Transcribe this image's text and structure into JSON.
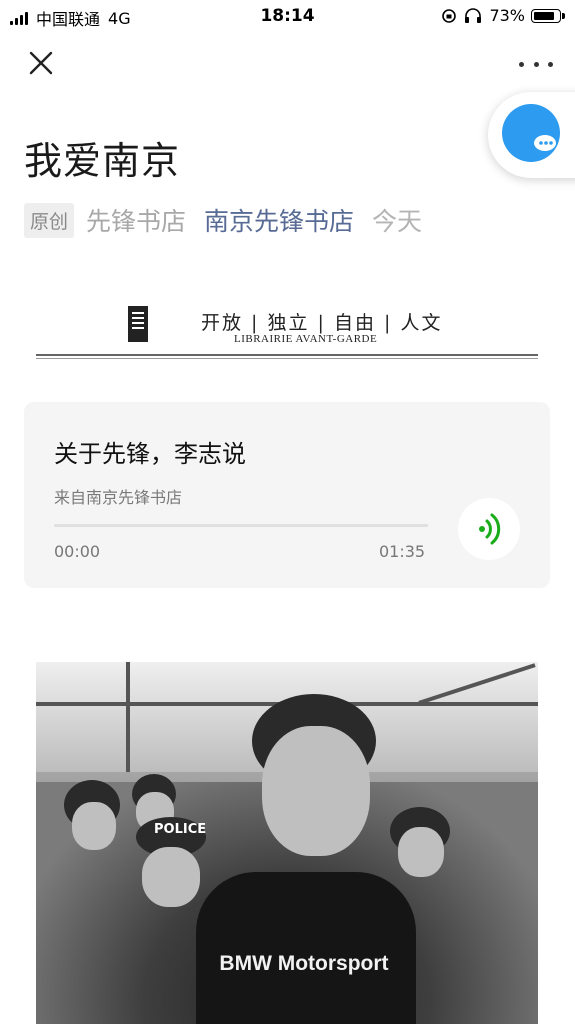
{
  "status_bar": {
    "carrier": "中国联通",
    "network": "4G",
    "time": "18:14",
    "battery": "73%"
  },
  "article": {
    "title": "我爱南京",
    "original_tag": "原创",
    "author": "先锋书店",
    "account": "南京先锋书店",
    "date": "今天"
  },
  "banner": {
    "slogan": "开放 | 独立 | 自由 | 人文",
    "subtitle": "LIBRAIRIE AVANT-GARDE"
  },
  "audio": {
    "title": "关于先锋，李志说",
    "source": "来自南京先锋书店",
    "time_current": "00:00",
    "time_total": "01:35",
    "progress": 0
  },
  "photo": {
    "shirt_text": "BMW Motorsport",
    "cap_text": "POLICE"
  },
  "colors": {
    "link": "#576b95",
    "audio_accent": "#1aad19",
    "chat_bubble": "#2d9cf0"
  },
  "icons": [
    "close-icon",
    "more-icon",
    "chat-icon",
    "audio-wave-icon",
    "signal-icon",
    "battery-icon"
  ]
}
